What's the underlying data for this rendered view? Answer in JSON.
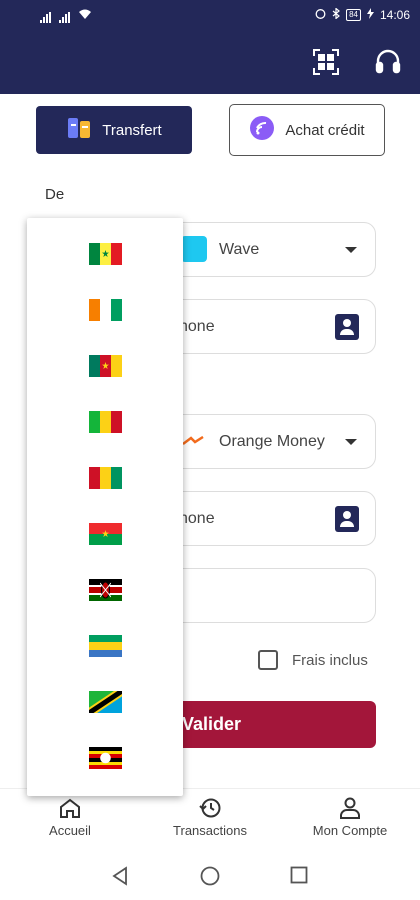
{
  "status_bar": {
    "time": "14:06",
    "battery": "84"
  },
  "tabs": {
    "transfert": "Transfert",
    "achat": "Achat crédit"
  },
  "form": {
    "from_label": "De",
    "from_operator": "Wave",
    "from_phone_partial": "hone",
    "to_operator": "Orange Money",
    "to_phone_partial": "hone",
    "fees_label": "Frais inclus",
    "submit_label": "Valider"
  },
  "country_dropdown": {
    "items": [
      "Senegal",
      "Cote d'Ivoire",
      "Cameroon",
      "Mali",
      "Guinea",
      "Burkina Faso",
      "Kenya",
      "Gabon",
      "Tanzania",
      "Uganda"
    ]
  },
  "bottom_nav": {
    "home": "Accueil",
    "transactions": "Transactions",
    "account": "Mon Compte"
  },
  "colors": {
    "primary": "#232859",
    "accent": "#a3163a",
    "purple": "#8b5cf6"
  }
}
